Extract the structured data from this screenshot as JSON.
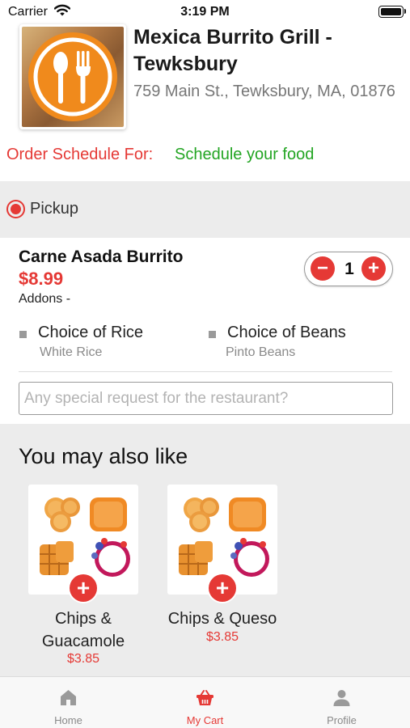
{
  "status_bar": {
    "carrier": "Carrier",
    "time": "3:19 PM"
  },
  "restaurant": {
    "name": "Mexica Burrito Grill - Tewksbury",
    "address": "759 Main St., Tewksbury, MA, 01876",
    "logo_icon": "fork-spoon-logo"
  },
  "schedule": {
    "label": "Order Schedule For:",
    "link": "Schedule your food"
  },
  "order_type": {
    "label": "Pickup",
    "selected": true
  },
  "cart_item": {
    "name": "Carne Asada Burrito",
    "price": "$8.99",
    "addons_label": "Addons -",
    "quantity": "1",
    "options": [
      {
        "title": "Choice of Rice",
        "value": "White Rice"
      },
      {
        "title": "Choice of Beans",
        "value": "Pinto Beans"
      }
    ]
  },
  "special_request": {
    "placeholder": "Any special request for the restaurant?",
    "value": ""
  },
  "recommendations": {
    "title": "You may also like",
    "items": [
      {
        "name": "Chips & Guacamole",
        "price": "$3.85"
      },
      {
        "name": "Chips & Queso",
        "price": "$3.85"
      }
    ]
  },
  "tab_bar": {
    "tabs": [
      {
        "label": "Home",
        "icon": "home-icon",
        "active": false
      },
      {
        "label": "My Cart",
        "icon": "basket-icon",
        "active": true
      },
      {
        "label": "Profile",
        "icon": "person-icon",
        "active": false
      }
    ]
  },
  "colors": {
    "accent_red": "#e53935",
    "link_green": "#23a523",
    "band_gray": "#ececec",
    "logo_orange": "#f08a1c"
  }
}
